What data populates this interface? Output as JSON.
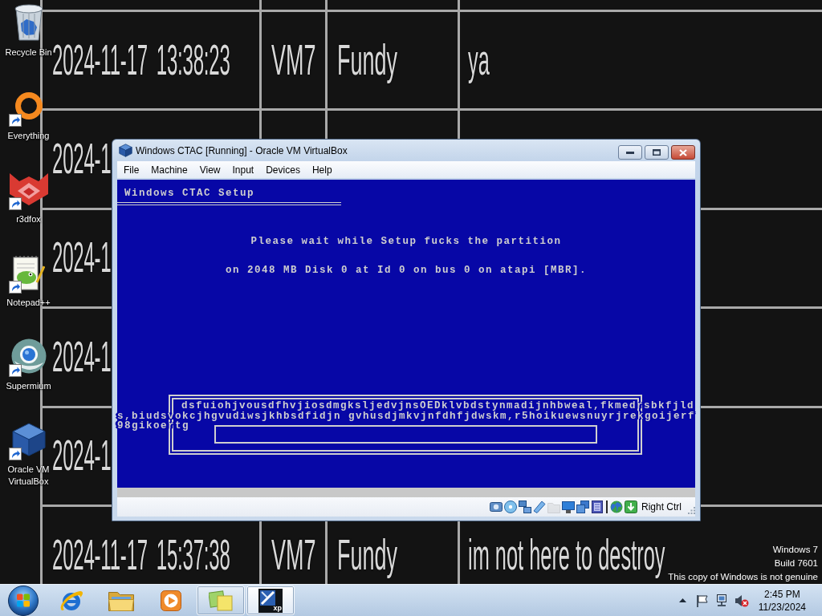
{
  "wallpaper": {
    "rows": [
      {
        "cells": [
          "2024-11-17 13:38:23",
          "VM7",
          "Fundy",
          "ya"
        ]
      },
      {
        "cells": [
          "2024-1"
        ]
      },
      {
        "cells": [
          "2024-1"
        ]
      },
      {
        "cells": [
          "2024-1"
        ]
      },
      {
        "cells": [
          "2024-1"
        ]
      },
      {
        "cells": [
          "2024-11-17 15:37:38",
          "VM7",
          "Fundy",
          "im not here to destroy"
        ]
      }
    ]
  },
  "desktop_icons": [
    {
      "label": "Recycle Bin",
      "kind": "recycle-bin",
      "shortcut": false
    },
    {
      "label": "Everything",
      "kind": "everything",
      "shortcut": true
    },
    {
      "label": "r3dfox",
      "kind": "r3dfox",
      "shortcut": true
    },
    {
      "label": "Notepad++",
      "kind": "notepad",
      "shortcut": true
    },
    {
      "label": "Supermium",
      "kind": "supermium",
      "shortcut": true
    },
    {
      "label": "Oracle VM VirtualBox",
      "kind": "virtualbox",
      "shortcut": true
    }
  ],
  "vm_window": {
    "title": "Windows CTAC [Running] - Oracle VM VirtualBox",
    "menu": [
      "File",
      "Machine",
      "View",
      "Input",
      "Devices",
      "Help"
    ],
    "guest_screen": {
      "header": "Windows CTAC Setup",
      "message_lines": [
        "Please wait while Setup fucks the partition",
        "on 2048 MB Disk 0 at Id 0 on bus 0 on atapi [MBR]."
      ],
      "dialog_text": "dsfuiohjvousdfhvjiosdmgksljedvjnsOEDklvbdstynmadijnhbweal,fkmedrsbkfjlds,biudsvokcjhgvudiwsjkhbsdfidjn gvhusdjmkvjnfdhfjdwskm,r5hoikuewsnuyrjrekgoijerf98gikoertg",
      "progress": {
        "level": 0
      }
    },
    "status_bar": {
      "devices": [
        {
          "kind": "hard-disk",
          "disabled": false
        },
        {
          "kind": "optical-drive",
          "disabled": false
        },
        {
          "kind": "network",
          "disabled": false
        },
        {
          "kind": "usb",
          "disabled": false
        },
        {
          "kind": "shared-folders",
          "disabled": true
        },
        {
          "kind": "display",
          "disabled": false
        },
        {
          "kind": "recording",
          "disabled": false
        },
        {
          "kind": "features",
          "disabled": false
        },
        {
          "kind": "mouse",
          "disabled": false
        },
        {
          "kind": "keyboard",
          "disabled": false
        }
      ],
      "host_key": "Right Ctrl"
    }
  },
  "watermark": [
    "Windows 7",
    "Build 7601",
    "This copy of Windows is not genuine"
  ],
  "taskbar": {
    "items": [
      {
        "kind": "browser",
        "running": false,
        "active": false
      },
      {
        "kind": "file-manager",
        "running": false,
        "active": false
      },
      {
        "kind": "media-player",
        "running": false,
        "active": false
      },
      {
        "kind": "sticky-notes",
        "running": true,
        "active": false
      },
      {
        "kind": "virtual-machine",
        "running": true,
        "active": true,
        "badge": "xp"
      }
    ],
    "tray": {
      "time": "2:45 PM",
      "date": "11/23/2024"
    }
  }
}
